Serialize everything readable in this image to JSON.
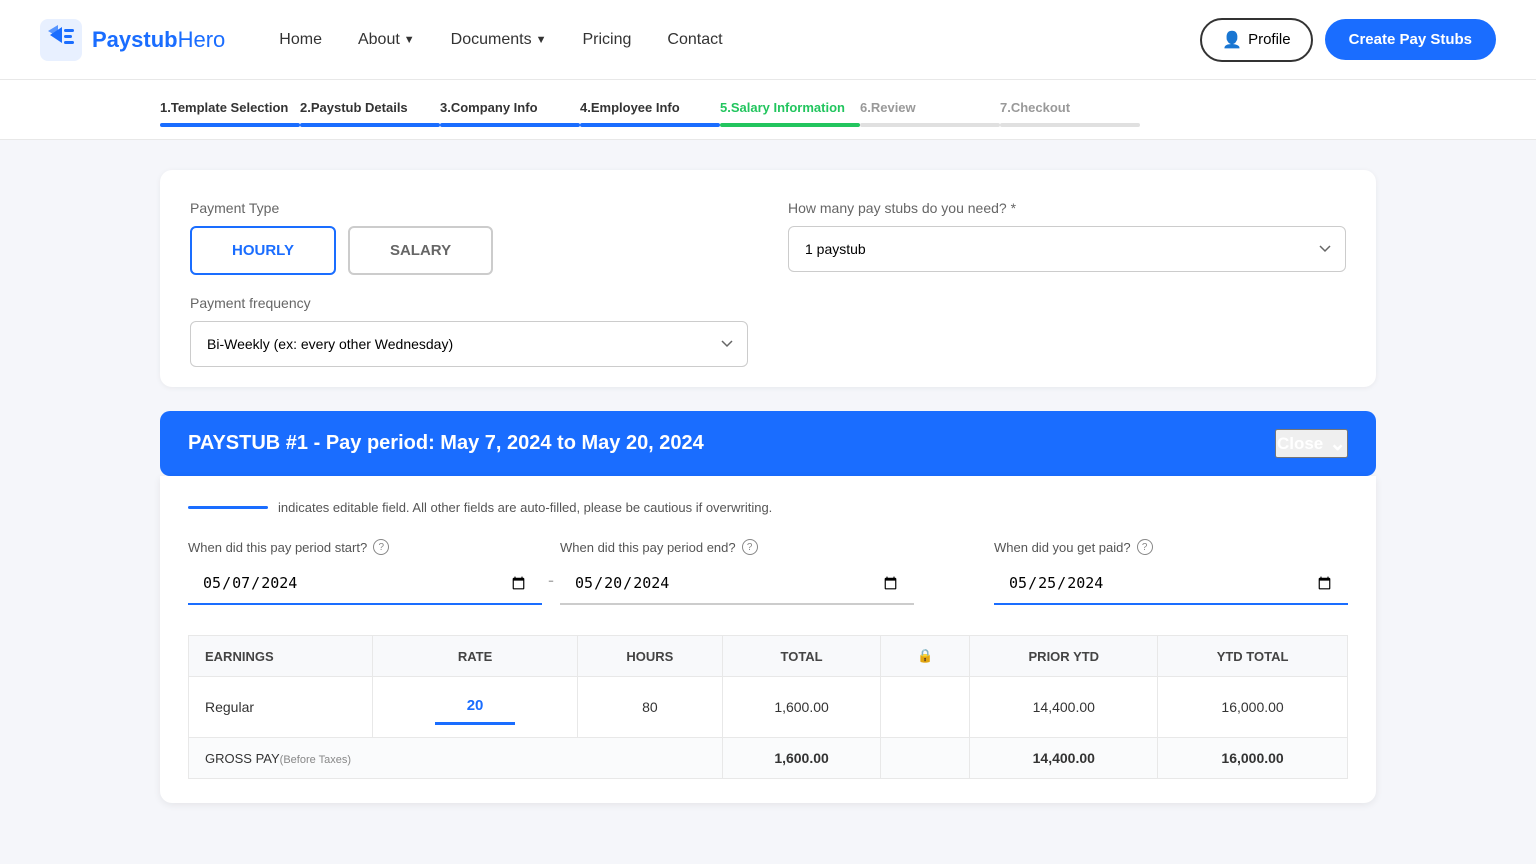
{
  "brand": {
    "name_part1": "Paystub",
    "name_part2": "Hero"
  },
  "nav": {
    "home": "Home",
    "about": "About",
    "documents": "Documents",
    "pricing": "Pricing",
    "contact": "Contact",
    "profile": "Profile",
    "create_btn": "Create Pay Stubs"
  },
  "steps": [
    {
      "id": 1,
      "label": "1.Template Selection",
      "state": "done"
    },
    {
      "id": 2,
      "label": "2.Paystub Details",
      "state": "done"
    },
    {
      "id": 3,
      "label": "3.Company Info",
      "state": "done"
    },
    {
      "id": 4,
      "label": "4.Employee Info",
      "state": "done"
    },
    {
      "id": 5,
      "label": "5.Salary Information",
      "state": "active-green"
    },
    {
      "id": 6,
      "label": "6.Review",
      "state": "inactive"
    },
    {
      "id": 7,
      "label": "7.Checkout",
      "state": "inactive"
    }
  ],
  "form": {
    "payment_type_label": "Payment Type",
    "hourly_label": "HOURLY",
    "salary_label": "SALARY",
    "payment_frequency_label": "Payment frequency",
    "frequency_selected": "Bi-Weekly (ex: every other Wednesday)",
    "paystubs_label": "How many pay stubs do you need? *",
    "paystubs_selected": "1 paystub"
  },
  "paystub": {
    "title": "PAYSTUB #1 -  Pay period: May 7, 2024 to May 20, 2024",
    "close_label": "Close",
    "note": "indicates editable field. All other fields are auto-filled, please be cautious if overwriting.",
    "start_label": "When did this pay period start?",
    "end_label": "When did this pay period end?",
    "paid_label": "When did you get paid?",
    "start_date": "07/05/2024",
    "end_date": "20/05/2024",
    "paid_date": "25/05/2024",
    "table": {
      "col_earnings": "EARNINGS",
      "col_rate": "RATE",
      "col_hours": "HOURS",
      "col_total": "TOTAL",
      "col_prior_ytd": "PRIOR YTD",
      "col_ytd_total": "YTD TOTAL",
      "rows": [
        {
          "label": "Regular",
          "rate": "20",
          "hours": "80",
          "total": "1,600.00",
          "prior_ytd": "14,400.00",
          "ytd_total": "16,000.00"
        }
      ],
      "gross_label": "GROSS PAY",
      "gross_sub": "(Before Taxes)",
      "gross_total": "1,600.00",
      "gross_prior_ytd": "14,400.00",
      "gross_ytd_total": "16,000.00"
    }
  }
}
